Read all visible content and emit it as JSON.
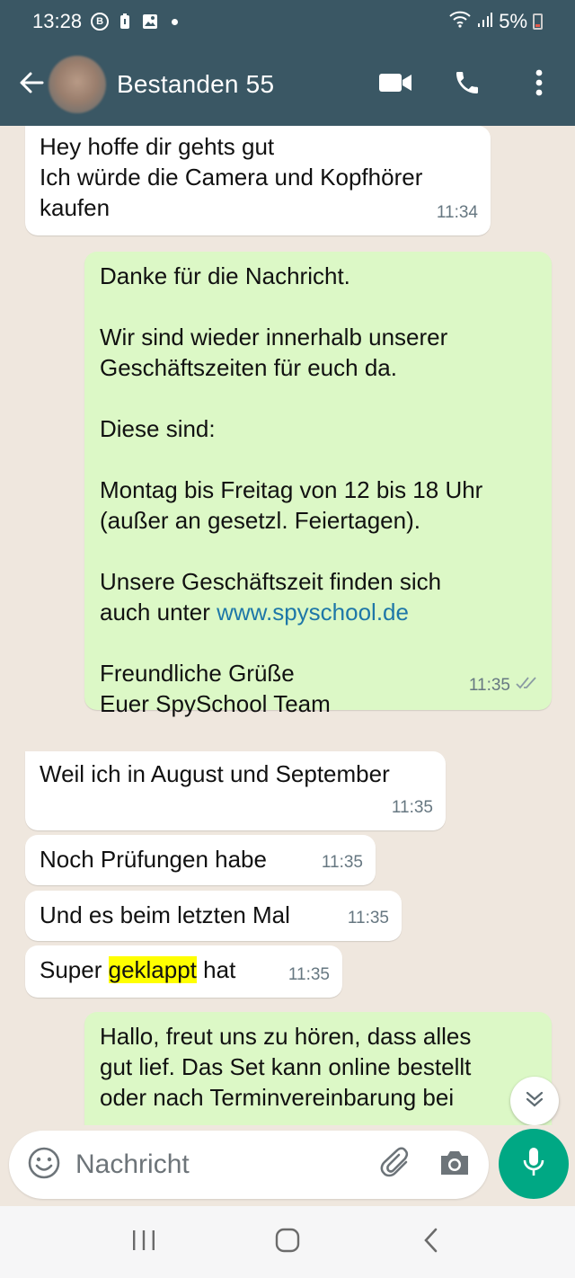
{
  "status_bar": {
    "time": "13:28",
    "battery_text": "5%",
    "icons": [
      "b-circle-icon",
      "battery-notification-icon",
      "image-icon",
      "dot-icon",
      "wifi-icon",
      "signal-icon",
      "battery-icon"
    ]
  },
  "header": {
    "title": "Bestanden 55",
    "icons": [
      "back-arrow-icon",
      "video-call-icon",
      "phone-icon",
      "more-vert-icon"
    ]
  },
  "messages": [
    {
      "direction": "incoming",
      "text": "Hey hoffe dir gehts gut\nIch würde die Camera und Kopfhörer\nkaufen",
      "time": "11:34"
    },
    {
      "direction": "outgoing",
      "text_1": "Danke für die Nachricht.\n\nWir sind wieder innerhalb unserer\nGeschäftszeiten für euch da.\n\nDiese sind:\n\nMontag bis Freitag von 12 bis 18 Uhr\n(außer an gesetzl. Feiertagen).\n\nUnsere Geschäftszeit finden sich\nauch unter ",
      "link": "www.spyschool.de",
      "text_2": "\n\nFreundliche Grüße\nEuer SpySchool Team",
      "time": "11:35",
      "status": "read-double-check"
    },
    {
      "direction": "incoming",
      "text": "Weil ich in August und September",
      "time": "11:35"
    },
    {
      "direction": "incoming",
      "text": "Noch Prüfungen habe",
      "time": "11:35"
    },
    {
      "direction": "incoming",
      "text": "Und es beim letzten Mal",
      "time": "11:35"
    },
    {
      "direction": "incoming",
      "text_before": "Super ",
      "highlight": "geklappt",
      "text_after": " hat",
      "time": "11:35"
    },
    {
      "direction": "outgoing",
      "text": "Hallo, freut uns zu hören, dass alles\ngut lief. Das Set kann online bestellt\noder nach Terminvereinbarung bei",
      "time": ""
    }
  ],
  "composer": {
    "placeholder": "Nachricht",
    "icons": [
      "emoji-icon",
      "attach-icon",
      "camera-icon",
      "mic-icon"
    ]
  },
  "nav_bar": {
    "icons": [
      "recent-apps-icon",
      "home-icon",
      "back-icon"
    ]
  },
  "colors": {
    "header_bg": "#3a5764",
    "chat_bg": "#efe7de",
    "outgoing_bubble": "#dcf8c6",
    "incoming_bubble": "#ffffff",
    "accent_green": "#00a884",
    "link": "#1e77a8",
    "highlight": "#ffff00"
  }
}
